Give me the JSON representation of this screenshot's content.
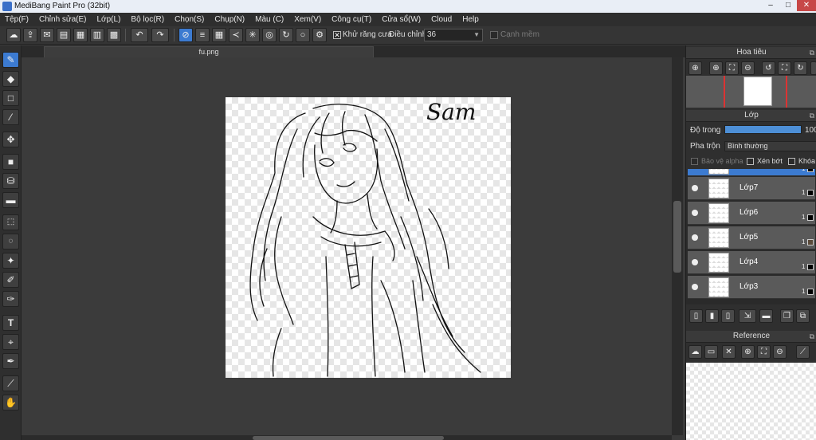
{
  "window": {
    "title": "MediBang Paint Pro (32bit)",
    "minimize": "–",
    "maximize": "□",
    "close": "✕"
  },
  "menu": [
    "Tệp(F)",
    "Chỉnh sửa(E)",
    "Lớp(L)",
    "Bộ lọc(R)",
    "Chọn(S)",
    "Chụp(N)",
    "Màu (C)",
    "Xem(V)",
    "Công cụ(T)",
    "Cửa sổ(W)",
    "Cloud",
    "Help"
  ],
  "toolbar": {
    "antialias_label": "Khử răng cưa",
    "antialias_checked": "✕",
    "adjust_label": "Điều chỉnh",
    "adjust_value": "36",
    "soft_edge_label": "Cạnh mềm",
    "dropdown_arrow": "▼"
  },
  "document": {
    "tab_name": "fu.png"
  },
  "canvas": {
    "signature_text": "Sam"
  },
  "navigator": {
    "title": "Hoa tiêu",
    "pop_icon": "⧉"
  },
  "layers": {
    "title": "Lớp",
    "pop_icon": "⧉",
    "opacity_label": "Độ trong",
    "opacity_value": "100",
    "opacity_level": 1.0,
    "blend_label": "Pha trộn",
    "blend_value": "Bình thường",
    "protect_alpha_label": "Bảo vệ alpha",
    "clipping_label": "Xén bớt",
    "lock_label": "Khóa",
    "items": [
      {
        "name": "",
        "num": "1"
      },
      {
        "name": "Lớp7",
        "num": "1"
      },
      {
        "name": "Lớp6",
        "num": "1"
      },
      {
        "name": "Lớp5",
        "num": "1"
      },
      {
        "name": "Lớp4",
        "num": "1"
      },
      {
        "name": "Lớp3",
        "num": "1"
      }
    ]
  },
  "reference": {
    "title": "Reference",
    "pop_icon": "⧉"
  },
  "colors": {
    "accent": "#3c7bd1",
    "close_red": "#c74848"
  }
}
